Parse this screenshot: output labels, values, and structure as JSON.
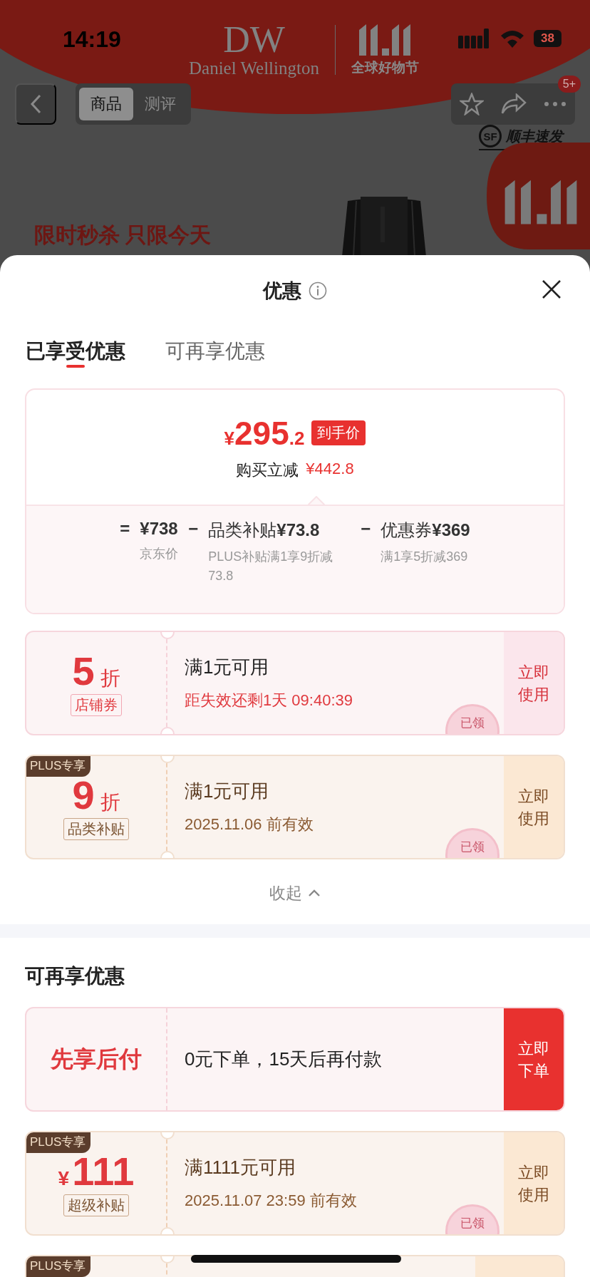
{
  "status_bar": {
    "time": "14:19",
    "battery": "38"
  },
  "banner": {
    "logo": "DW",
    "brand": "Daniel Wellington",
    "event": "全球好物节"
  },
  "nav": {
    "tabs": [
      {
        "label": "商品",
        "selected": true
      },
      {
        "label": "测评",
        "selected": false
      }
    ],
    "badge": "5+"
  },
  "product": {
    "shipping_logo": "SF",
    "shipping": "顺丰速发",
    "promo": "限时秒杀 只限今天"
  },
  "sheet": {
    "title": "优惠",
    "tabs": [
      {
        "label": "已享受优惠",
        "selected": true
      },
      {
        "label": "可再享优惠",
        "selected": false
      }
    ],
    "summary": {
      "currency": "¥",
      "price": "295",
      "decimal": ".2",
      "tag": "到手价",
      "saving_label": "购买立减",
      "saving": "¥442.8",
      "breakdown": [
        {
          "op": "=",
          "amount": "¥738",
          "note": "京东价"
        },
        {
          "op": "−",
          "label": "品类补贴",
          "amount": "¥73.8",
          "note": "PLUS补贴满1享9折减73.8"
        },
        {
          "op": "−",
          "label": "优惠券",
          "amount": "¥369",
          "note": "满1享5折减369"
        }
      ]
    },
    "coupons": [
      {
        "kind": "discount",
        "value": "5",
        "unit": "折",
        "tag": "店铺券",
        "condition": "满1元可用",
        "detail": "距失效还剩1天 09:40:39",
        "action": "立即使用",
        "stamp": "已领"
      },
      {
        "kind": "discount",
        "badge": "PLUS专享",
        "value": "9",
        "unit": "折",
        "tag": "品类补贴",
        "condition": "满1元可用",
        "detail": "2025.11.06 前有效",
        "action": "立即使用",
        "stamp": "已领"
      }
    ],
    "collapse": "收起",
    "more": {
      "title": "可再享优惠",
      "offers": [
        {
          "kind": "pay_later",
          "title": "先享后付",
          "condition": "0元下单，15天后再付款",
          "action": "立即下单"
        },
        {
          "kind": "amount",
          "badge": "PLUS专享",
          "currency": "¥",
          "value": "111",
          "tag": "超级补贴",
          "condition": "满1111元可用",
          "detail": "2025.11.07 23:59 前有效",
          "action": "立即使用",
          "stamp": "已领"
        },
        {
          "kind": "amount",
          "badge": "PLUS专享"
        }
      ]
    }
  }
}
